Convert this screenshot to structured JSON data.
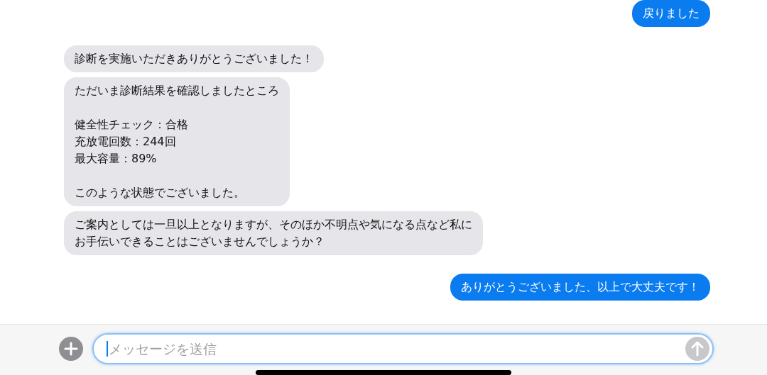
{
  "messages": [
    {
      "kind": "outgoing",
      "paragraphs": [
        [
          "戻りました"
        ]
      ]
    },
    {
      "kind": "incoming",
      "paragraphs": [
        [
          "診断を実施いただきありがとうございました！"
        ]
      ]
    },
    {
      "kind": "incoming",
      "paragraphs": [
        [
          "ただいま診断結果を確認しましたところ"
        ],
        [
          "健全性チェック：合格",
          "充放電回数：244回",
          "最大容量：89%"
        ],
        [
          "このような状態でございました。"
        ]
      ]
    },
    {
      "kind": "incoming",
      "paragraphs": [
        [
          "ご案内としては一旦以上となりますが、そのほか不明点や気になる点など私に",
          "お手伝いできることはございませんでしょうか？"
        ]
      ]
    },
    {
      "kind": "outgoing",
      "paragraphs": [
        [
          "ありがとうございました、以上で大丈夫です！"
        ]
      ]
    }
  ],
  "composer": {
    "placeholder": "メッセージを送信"
  }
}
